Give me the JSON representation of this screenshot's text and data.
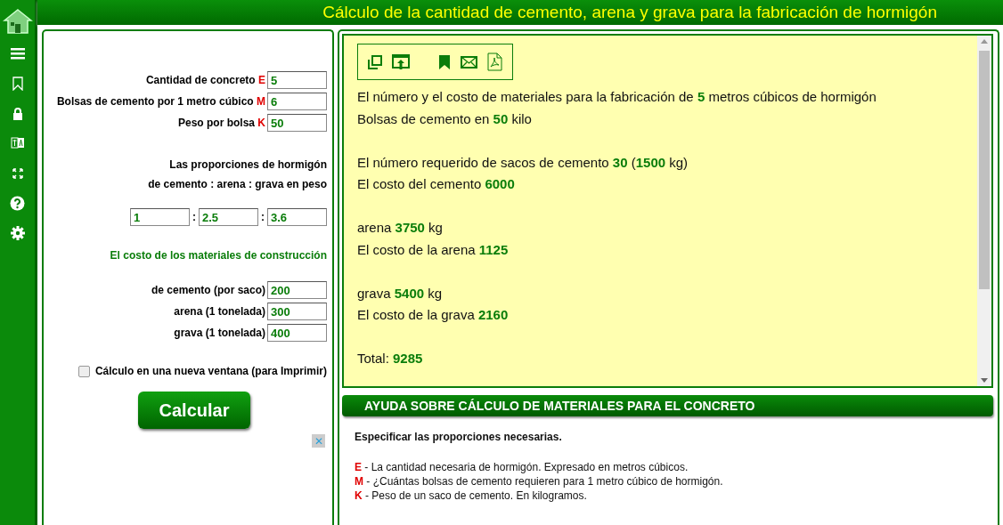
{
  "header": {
    "title": "Cálculo de la cantidad de cemento, arena y grava para la fabricación de hormigón"
  },
  "sidebar": {
    "items": [
      {
        "kind": "home"
      },
      {
        "kind": "menu"
      },
      {
        "kind": "bookmark"
      },
      {
        "kind": "lock"
      },
      {
        "kind": "translate"
      },
      {
        "kind": "expand"
      },
      {
        "kind": "help"
      },
      {
        "kind": "settings"
      }
    ]
  },
  "form": {
    "inputs": [
      {
        "label": "Cantidad de concreto",
        "letter": "E",
        "value": "5"
      },
      {
        "label": "Bolsas de cemento por 1 metro cúbico",
        "letter": "M",
        "value": "6"
      },
      {
        "label": "Peso por bolsa",
        "letter": "K",
        "value": "50"
      }
    ],
    "proportions_title": [
      "Las proporciones de hormigón",
      "de cemento : arena : grava en peso"
    ],
    "proportions": [
      "1",
      "2.5",
      "3.6"
    ],
    "separator": ":",
    "cost_title": "El costo de los materiales de construcción",
    "costs": [
      {
        "label": "de cemento (por saco)",
        "value": "200"
      },
      {
        "label": "arena (1 tonelada)",
        "value": "300"
      },
      {
        "label": "grava (1 tonelada)",
        "value": "400"
      }
    ],
    "new_window": {
      "label": "Cálculo en una nueva ventana (para Imprimir)",
      "checked": false
    },
    "button": "Calcular",
    "ad_close": "✕"
  },
  "result": {
    "toolbar": [
      {
        "kind": "copy"
      },
      {
        "kind": "open"
      },
      {
        "kind": "bookmark"
      },
      {
        "kind": "mail"
      },
      {
        "kind": "pdf"
      }
    ],
    "groups": [
      [
        "El número y el costo de materiales para la fabricación de **5** metros cúbicos de hormigón",
        "Bolsas de cemento en **50** kilo"
      ],
      [
        "El número requerido de sacos de cemento **30** (**1500** kg)",
        "El costo del cemento **6000**"
      ],
      [
        "arena **3750** kg",
        "El costo de la arena **1125**"
      ],
      [
        "grava **5400** kg",
        "El costo de la grava **2160**"
      ],
      [
        "Total: **9285**"
      ]
    ]
  },
  "help": {
    "title": "AYUDA SOBRE CÁLCULO DE MATERIALES PARA EL CONCRETO",
    "intro": "Especificar las proporciones necesarias.",
    "items": [
      {
        "letter": "E",
        "text": " - La cantidad necesaria de hormigón. Expresado en metros cúbicos."
      },
      {
        "letter": "M",
        "text": " - ¿Cuántas bolsas de cemento requieren para 1 metro cúbico de hormigón."
      },
      {
        "letter": "K",
        "text": " - Peso de un saco de cemento. En kilogramos."
      }
    ]
  }
}
